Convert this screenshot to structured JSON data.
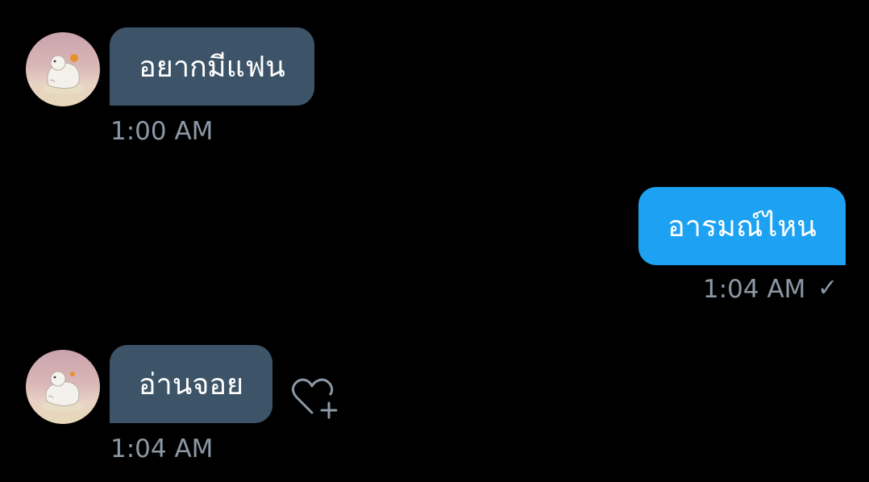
{
  "messages": [
    {
      "direction": "received",
      "text": "อยากมีแฟน",
      "time": "1:00 AM"
    },
    {
      "direction": "sent",
      "text": "อารมณ์ไหน",
      "time": "1:04 AM",
      "status_icon": "checkmark-icon"
    },
    {
      "direction": "received",
      "text": "อ่านจอย",
      "time": "1:04 AM",
      "reaction_icon": "heart-plus-icon"
    }
  ],
  "colors": {
    "background": "#000000",
    "received_bubble": "#3d5468",
    "sent_bubble": "#1da1f2",
    "timestamp": "#8b98a5",
    "text": "#ffffff"
  },
  "status": {
    "check_glyph": "✓"
  }
}
